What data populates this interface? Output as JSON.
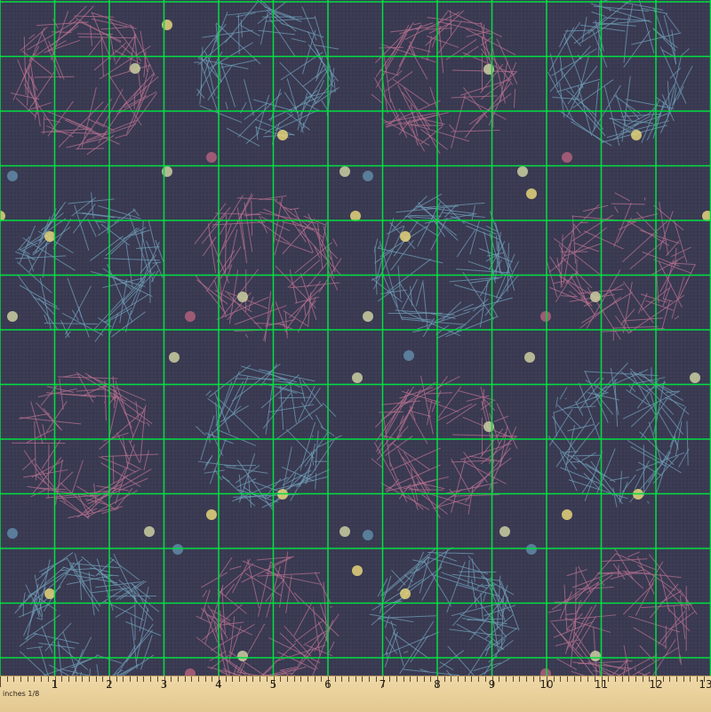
{
  "image": {
    "subject": "printed fabric swatch with measuring ruler",
    "background_color": "#3a3a52",
    "motif_colors": {
      "pink": "#b5708e",
      "blue": "#6f9db5"
    },
    "dot_colors": [
      "#e5d57a",
      "#cbcfa0",
      "#5f8aa8",
      "#b0607a",
      "#9bb0a8"
    ],
    "grid_color": "#00e040"
  },
  "ruler": {
    "unit_label": "inches 1/8",
    "numbers": [
      "1",
      "2",
      "3",
      "4",
      "5",
      "6",
      "7",
      "8",
      "9",
      "10",
      "11",
      "12",
      "13"
    ]
  }
}
